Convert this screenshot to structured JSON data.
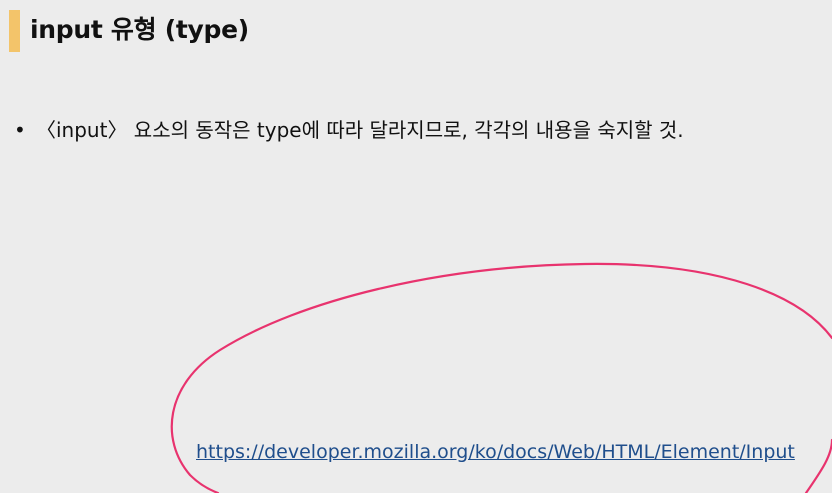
{
  "slide": {
    "title": "input 유형 (type)",
    "bullets": [
      {
        "marker": "•",
        "text": "〈input〉 요소의 동작은 type에 따라 달라지므로, 각각의 내용을 숙지할 것."
      }
    ],
    "reference_link": "https://developer.mozilla.org/ko/docs/Web/HTML/Element/Input"
  },
  "colors": {
    "background": "#ececec",
    "title_accent": "#f3c46a",
    "link": "#1f4e8c",
    "annotation_pen": "#e8336e"
  }
}
